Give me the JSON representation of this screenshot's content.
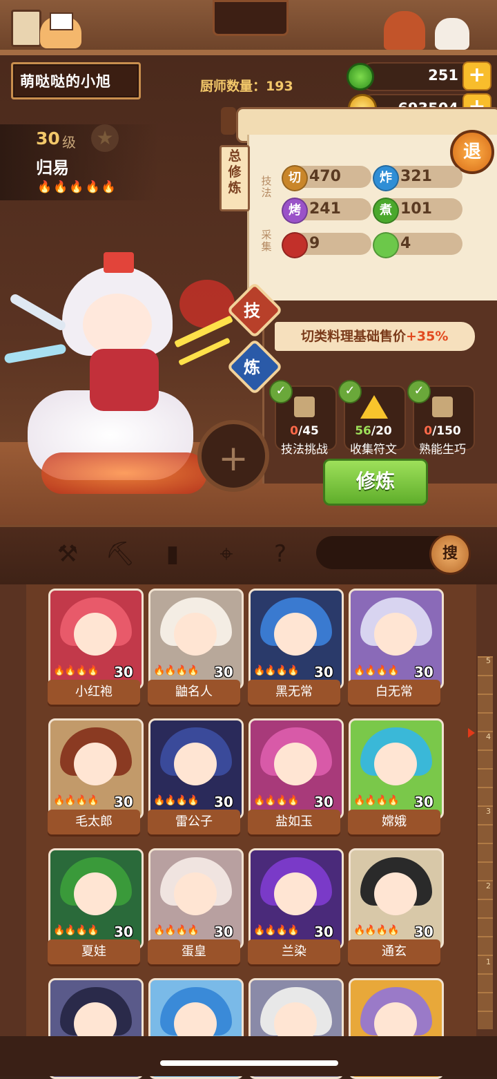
{
  "player": {
    "name": "萌哒哒的小旭",
    "chef_count_label": "厨师数量：",
    "chef_count": "193"
  },
  "resources": {
    "jade": "251",
    "coins": "693504"
  },
  "character": {
    "level": "30",
    "level_unit": "级",
    "name": "归易",
    "flames": "🔥🔥🔥🔥🔥",
    "star_rank": 5
  },
  "cultivation": {
    "tab_label": "总修炼",
    "technique_label": "技法",
    "gather_label": "采集",
    "stats": [
      {
        "icon_char": "切",
        "value": "470",
        "color": "#c9862a"
      },
      {
        "icon_char": "炸",
        "value": "321",
        "color": "#2f8ed6"
      },
      {
        "icon_char": "烤",
        "value": "241",
        "color": "#9a52c8"
      },
      {
        "icon_char": "煮",
        "value": "101",
        "color": "#4aa82c"
      },
      {
        "icon_char": "",
        "value": "9",
        "color": "#c2302a"
      },
      {
        "icon_char": "",
        "value": "4",
        "color": "#6cc84a"
      }
    ],
    "retreat": "退",
    "skill_tab": "技",
    "refine_tab": "炼",
    "bonus_text": "切类料理基础售价",
    "bonus_pct": "+35%",
    "tasks": [
      {
        "current": "0",
        "total": "/45",
        "label": "技法挑战",
        "progress_color": "#ff6a4a"
      },
      {
        "current": "56",
        "total": "/20",
        "label": "收集符文",
        "progress_color": "#9ee05a"
      },
      {
        "current": "0",
        "total": "/150",
        "label": "熟能生巧",
        "progress_color": "#ff6a4a"
      }
    ],
    "cultivate_button": "修炼",
    "add_button": "+"
  },
  "filters": {
    "icons": [
      "shovel-icon",
      "shovel-alt-icon",
      "jar-icon",
      "location-pin-icon",
      "map-question-icon"
    ],
    "search_button": "搜"
  },
  "roster": [
    {
      "name": "小红袍",
      "level": "30",
      "hair": "#e85a6a",
      "bg": "#c2394a"
    },
    {
      "name": "鼬名人",
      "level": "30",
      "hair": "#f4ede4",
      "bg": "#b8a89a"
    },
    {
      "name": "黑无常",
      "level": "30",
      "hair": "#3a7ad0",
      "bg": "#2a3a6a"
    },
    {
      "name": "白无常",
      "level": "30",
      "hair": "#d8d4f0",
      "bg": "#8a6ab8"
    },
    {
      "name": "毛太郎",
      "level": "30",
      "hair": "#8a3a22",
      "bg": "#c29a6a"
    },
    {
      "name": "雷公子",
      "level": "30",
      "hair": "#3a4a9a",
      "bg": "#2a2a5a"
    },
    {
      "name": "盐如玉",
      "level": "30",
      "hair": "#d85aa8",
      "bg": "#a83a7a"
    },
    {
      "name": "嫦娥",
      "level": "30",
      "hair": "#3ab8d8",
      "bg": "#7ac84a"
    },
    {
      "name": "夏娃",
      "level": "30",
      "hair": "#3a9a3a",
      "bg": "#2a6a3a"
    },
    {
      "name": "蛋皇",
      "level": "30",
      "hair": "#f0e4e0",
      "bg": "#b8a0a0"
    },
    {
      "name": "兰染",
      "level": "30",
      "hair": "#7a3ac8",
      "bg": "#4a2a7a"
    },
    {
      "name": "通玄",
      "level": "30",
      "hair": "#2a2a2a",
      "bg": "#d8c8a8"
    },
    {
      "name": "",
      "level": "",
      "hair": "#2a2a4a",
      "bg": "#5a5a8a"
    },
    {
      "name": "",
      "level": "",
      "hair": "#3a8ad8",
      "bg": "#7abae8"
    },
    {
      "name": "",
      "level": "",
      "hair": "#e8e8e8",
      "bg": "#8a8aa8"
    },
    {
      "name": "",
      "level": "",
      "hair": "#9a7ac8",
      "bg": "#e8a83a"
    }
  ],
  "ruler_labels": [
    "5",
    "4",
    "3",
    "2",
    "1",
    "1"
  ]
}
